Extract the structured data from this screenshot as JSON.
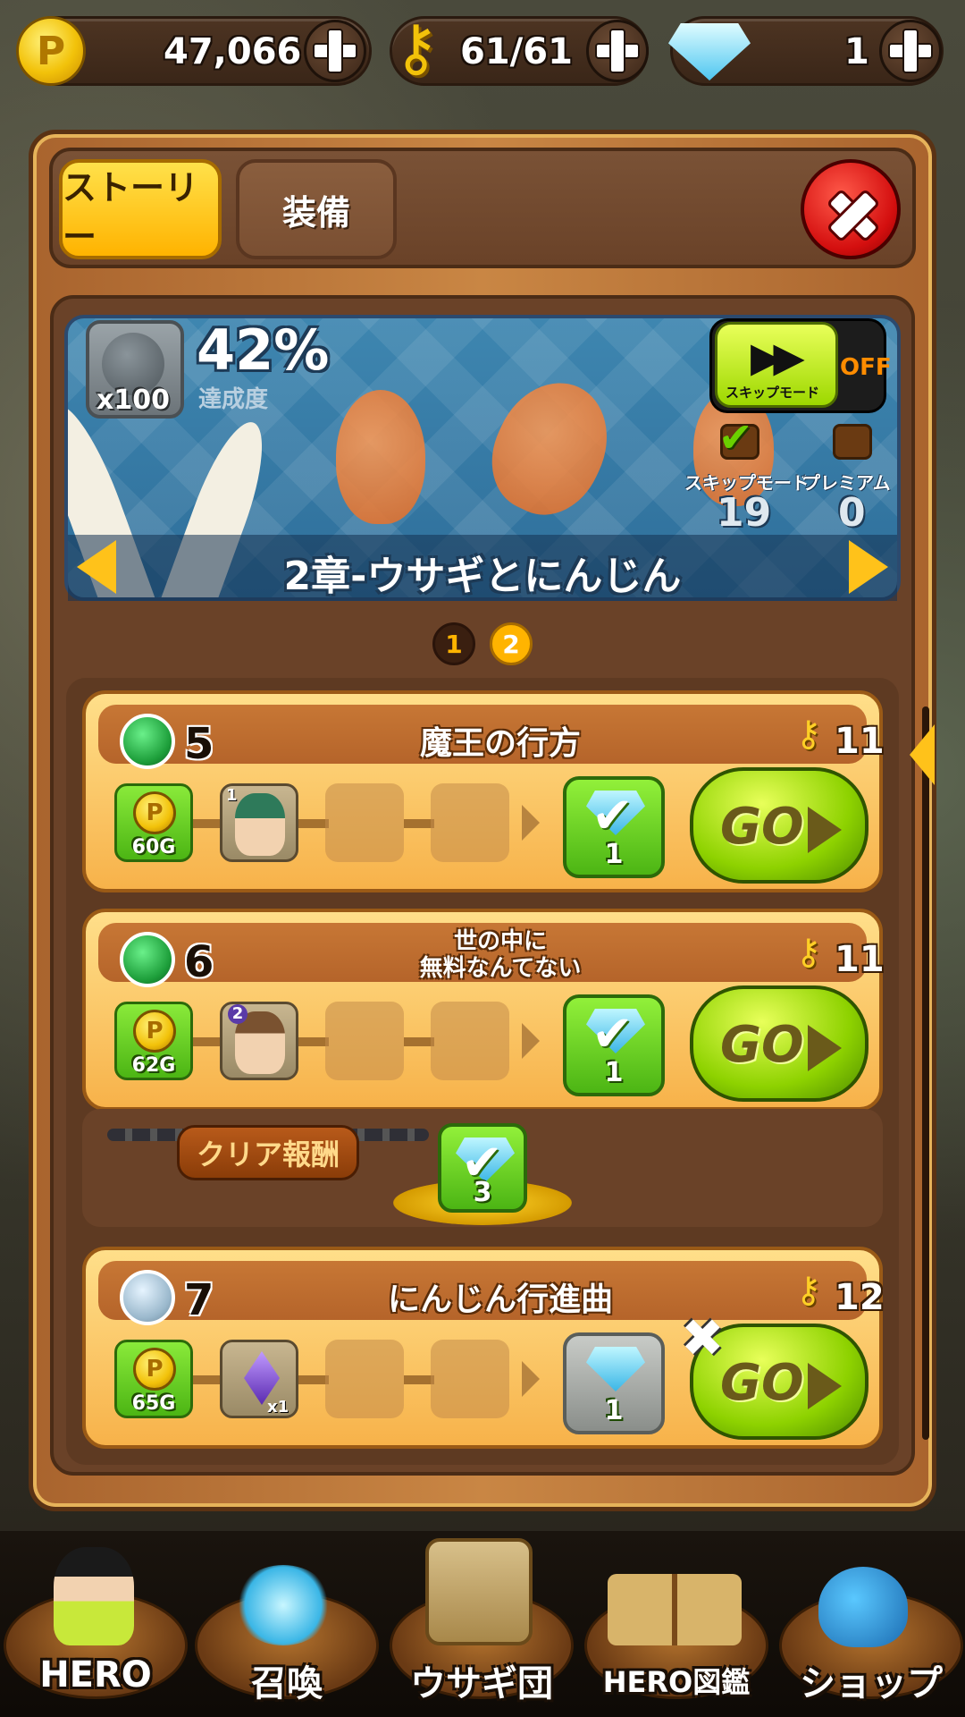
{
  "resources": {
    "coins": "47,066",
    "keys": "61/61",
    "gems": "1"
  },
  "tabs": {
    "story": "ストーリー",
    "equipment": "装備"
  },
  "banner": {
    "medal_count": "x100",
    "progress": "42%",
    "progress_label": "達成度",
    "skip_button": "スキップモード",
    "skip_state": "OFF",
    "skip_mode_label": "スキップモード",
    "premium_label": "プレミアム",
    "skip_mode_count": "19",
    "premium_count": "0",
    "chapter_title": "2章-ウサギとにんじん"
  },
  "pages": [
    "1",
    "2"
  ],
  "current_page": "2",
  "stages": [
    {
      "number": "5",
      "title": "魔王の行方",
      "keys": "11",
      "gold": "60G",
      "gem_reward": "1",
      "hero_level": "1",
      "icon": "leaf-icon"
    },
    {
      "number": "6",
      "title_line1": "世の中に",
      "title_line2": "無料なんてない",
      "keys": "11",
      "gold": "62G",
      "gem_reward": "1",
      "hero_level": "2",
      "icon": "leaf-icon"
    },
    {
      "number": "7",
      "title": "にんじん行進曲",
      "keys": "12",
      "gold": "65G",
      "gem_reward": "1",
      "item_count": "x1",
      "icon": "spiral-icon"
    }
  ],
  "clear_reward": {
    "label": "クリア報酬",
    "gems": "3"
  },
  "go_label": "GO",
  "nav": {
    "hero": "HERO",
    "summon": "召喚",
    "rabbit_team": "ウサギ団",
    "hero_book": "HERO図鑑",
    "shop": "ショップ"
  },
  "colors": {
    "accent_yellow": "#ffc21a",
    "go_green": "#8ed200",
    "close_red": "#d40f0f",
    "panel_brown": "#c98644"
  }
}
